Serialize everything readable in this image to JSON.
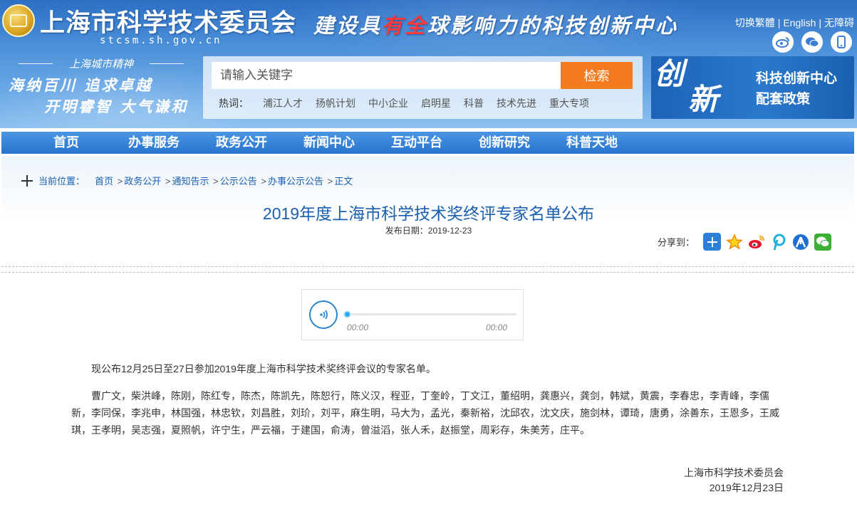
{
  "header": {
    "site_title": "上海市科学技术委员会",
    "site_domain": "stcsm.sh.gov.cn",
    "slogan_part1": "建设具",
    "slogan_highlight": "有全",
    "slogan_part2": "球影响力的科技创新中心",
    "links": [
      "切换繁體",
      "English",
      "无障碍"
    ],
    "link_separator": "|",
    "spirit_title": "上海城市精神",
    "spirit_line1": "海纳百川  追求卓越",
    "spirit_line2": "开明睿智  大气谦和"
  },
  "search": {
    "placeholder": "请输入关键字",
    "button_label": "检索",
    "hot_label": "热词：",
    "hot_keywords": [
      "浦江人才",
      "扬帆计划",
      "中小企业",
      "启明星",
      "科普",
      "技术先进",
      "重大专项"
    ]
  },
  "banner": {
    "big_char1": "创",
    "big_char2": "新",
    "line1": "科技创新中心",
    "line2": "配套政策"
  },
  "nav": [
    "首页",
    "办事服务",
    "政务公开",
    "新闻中心",
    "互动平台",
    "创新研究",
    "科普天地"
  ],
  "breadcrumb": {
    "label": "当前位置：",
    "items": [
      "首页",
      "政务公开",
      "通知告示",
      "公示公告",
      "办事公示公告",
      "正文"
    ],
    "separator": ">"
  },
  "article": {
    "title": "2019年度上海市科学技术奖终评专家名单公布",
    "publish_date": "发布日期：2019-12-23",
    "share_label": "分享到：",
    "audio_current": "00:00",
    "audio_total": "00:00",
    "audio_progress": 0,
    "intro": "现公布12月25日至27日参加2019年度上海市科学技术奖终评会议的专家名单。",
    "names": "曹广文，柴洪峰，陈刚，陈红专，陈杰，陈凯先，陈恕行，陈义汉，程亚，丁奎岭，丁文江，董绍明，龚惠兴，龚剑，韩斌，黄震，李春忠，李青峰，李儒新，李同保，李兆申，林国强，林忠钦，刘昌胜，刘玠，刘平，麻生明，马大为，孟光，秦新裕，沈邱农，沈文庆，施剑林，谭琦，唐勇，涂善东，王恩多，王威琪，王孝明，吴志强，夏照帆，许宁生，严云福，于建国，俞涛，曾溢滔，张人禾，赵振堂，周彩存，朱美芳，庄平。",
    "signature_org": "上海市科学技术委员会",
    "signature_date": "2019年12月23日"
  },
  "colors": {
    "header_blue": "#2d6fc4",
    "nav_blue": "#2873cc",
    "link_blue": "#1a5fb0",
    "search_button_orange": "#f47b20"
  },
  "icons": {
    "logo": "shanghai-emblem-icon",
    "social": [
      "weibo-icon",
      "wechat-icon",
      "mobile-icon"
    ],
    "share": [
      "share-more-icon",
      "qzone-icon",
      "sina-weibo-icon",
      "pinterest-icon",
      "renren-icon",
      "wechat-icon"
    ]
  }
}
